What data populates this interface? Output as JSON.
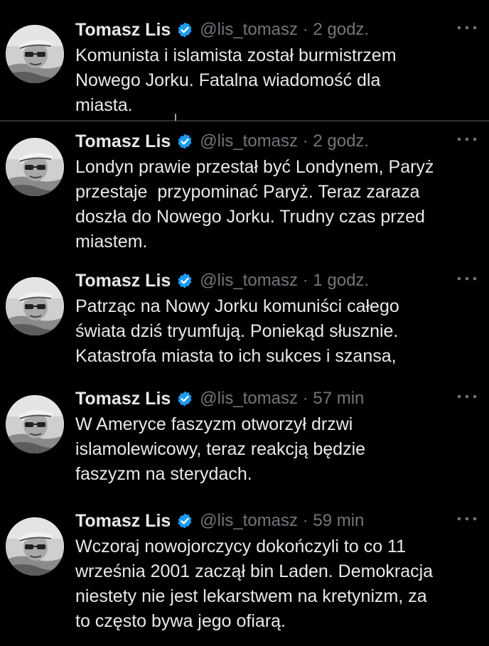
{
  "author": {
    "name": "Tomasz Lis",
    "handle": "@lis_tomasz",
    "verified_color": "#1d9bf0"
  },
  "colors": {
    "background": "#000000",
    "text": "#e7e9ea",
    "secondary": "#71767b"
  },
  "icons": {
    "verified": "verified-badge-icon",
    "more": "more-options-icon"
  },
  "tweets": [
    {
      "time": "2 godz.",
      "lines": [
        "Komunista i islamista został burmistrzem",
        "Nowego Jorku. Fatalna wiadomość dla",
        "miasta."
      ]
    },
    {
      "time": "2 godz.",
      "lines": [
        "Londyn prawie przestał być Londynem, Paryż",
        "przestaje  przypominać Paryż. Teraz zaraza",
        "doszła do Nowego Jorku. Trudny czas przed",
        "miastem."
      ]
    },
    {
      "time": "1 godz.",
      "lines": [
        "Patrząc na Nowy Jorku komuniści całego",
        "świata dziś tryumfują. Poniekąd słusznie.",
        "Katastrofa miasta to ich sukces i szansa,"
      ]
    },
    {
      "time": "57 min",
      "lines": [
        "W Ameryce faszyzm otworzył drzwi",
        "islamolewicowy, teraz reakcją będzie",
        "faszyzm na sterydach."
      ]
    },
    {
      "time": "59 min",
      "lines": [
        "Wczoraj nowojorczycy dokończyli to co 11",
        "września 2001 zaczął bin Laden. Demokracja",
        "niestety nie jest lekarstwem na kretynizm, za",
        "to często bywa jego ofiarą."
      ]
    }
  ]
}
